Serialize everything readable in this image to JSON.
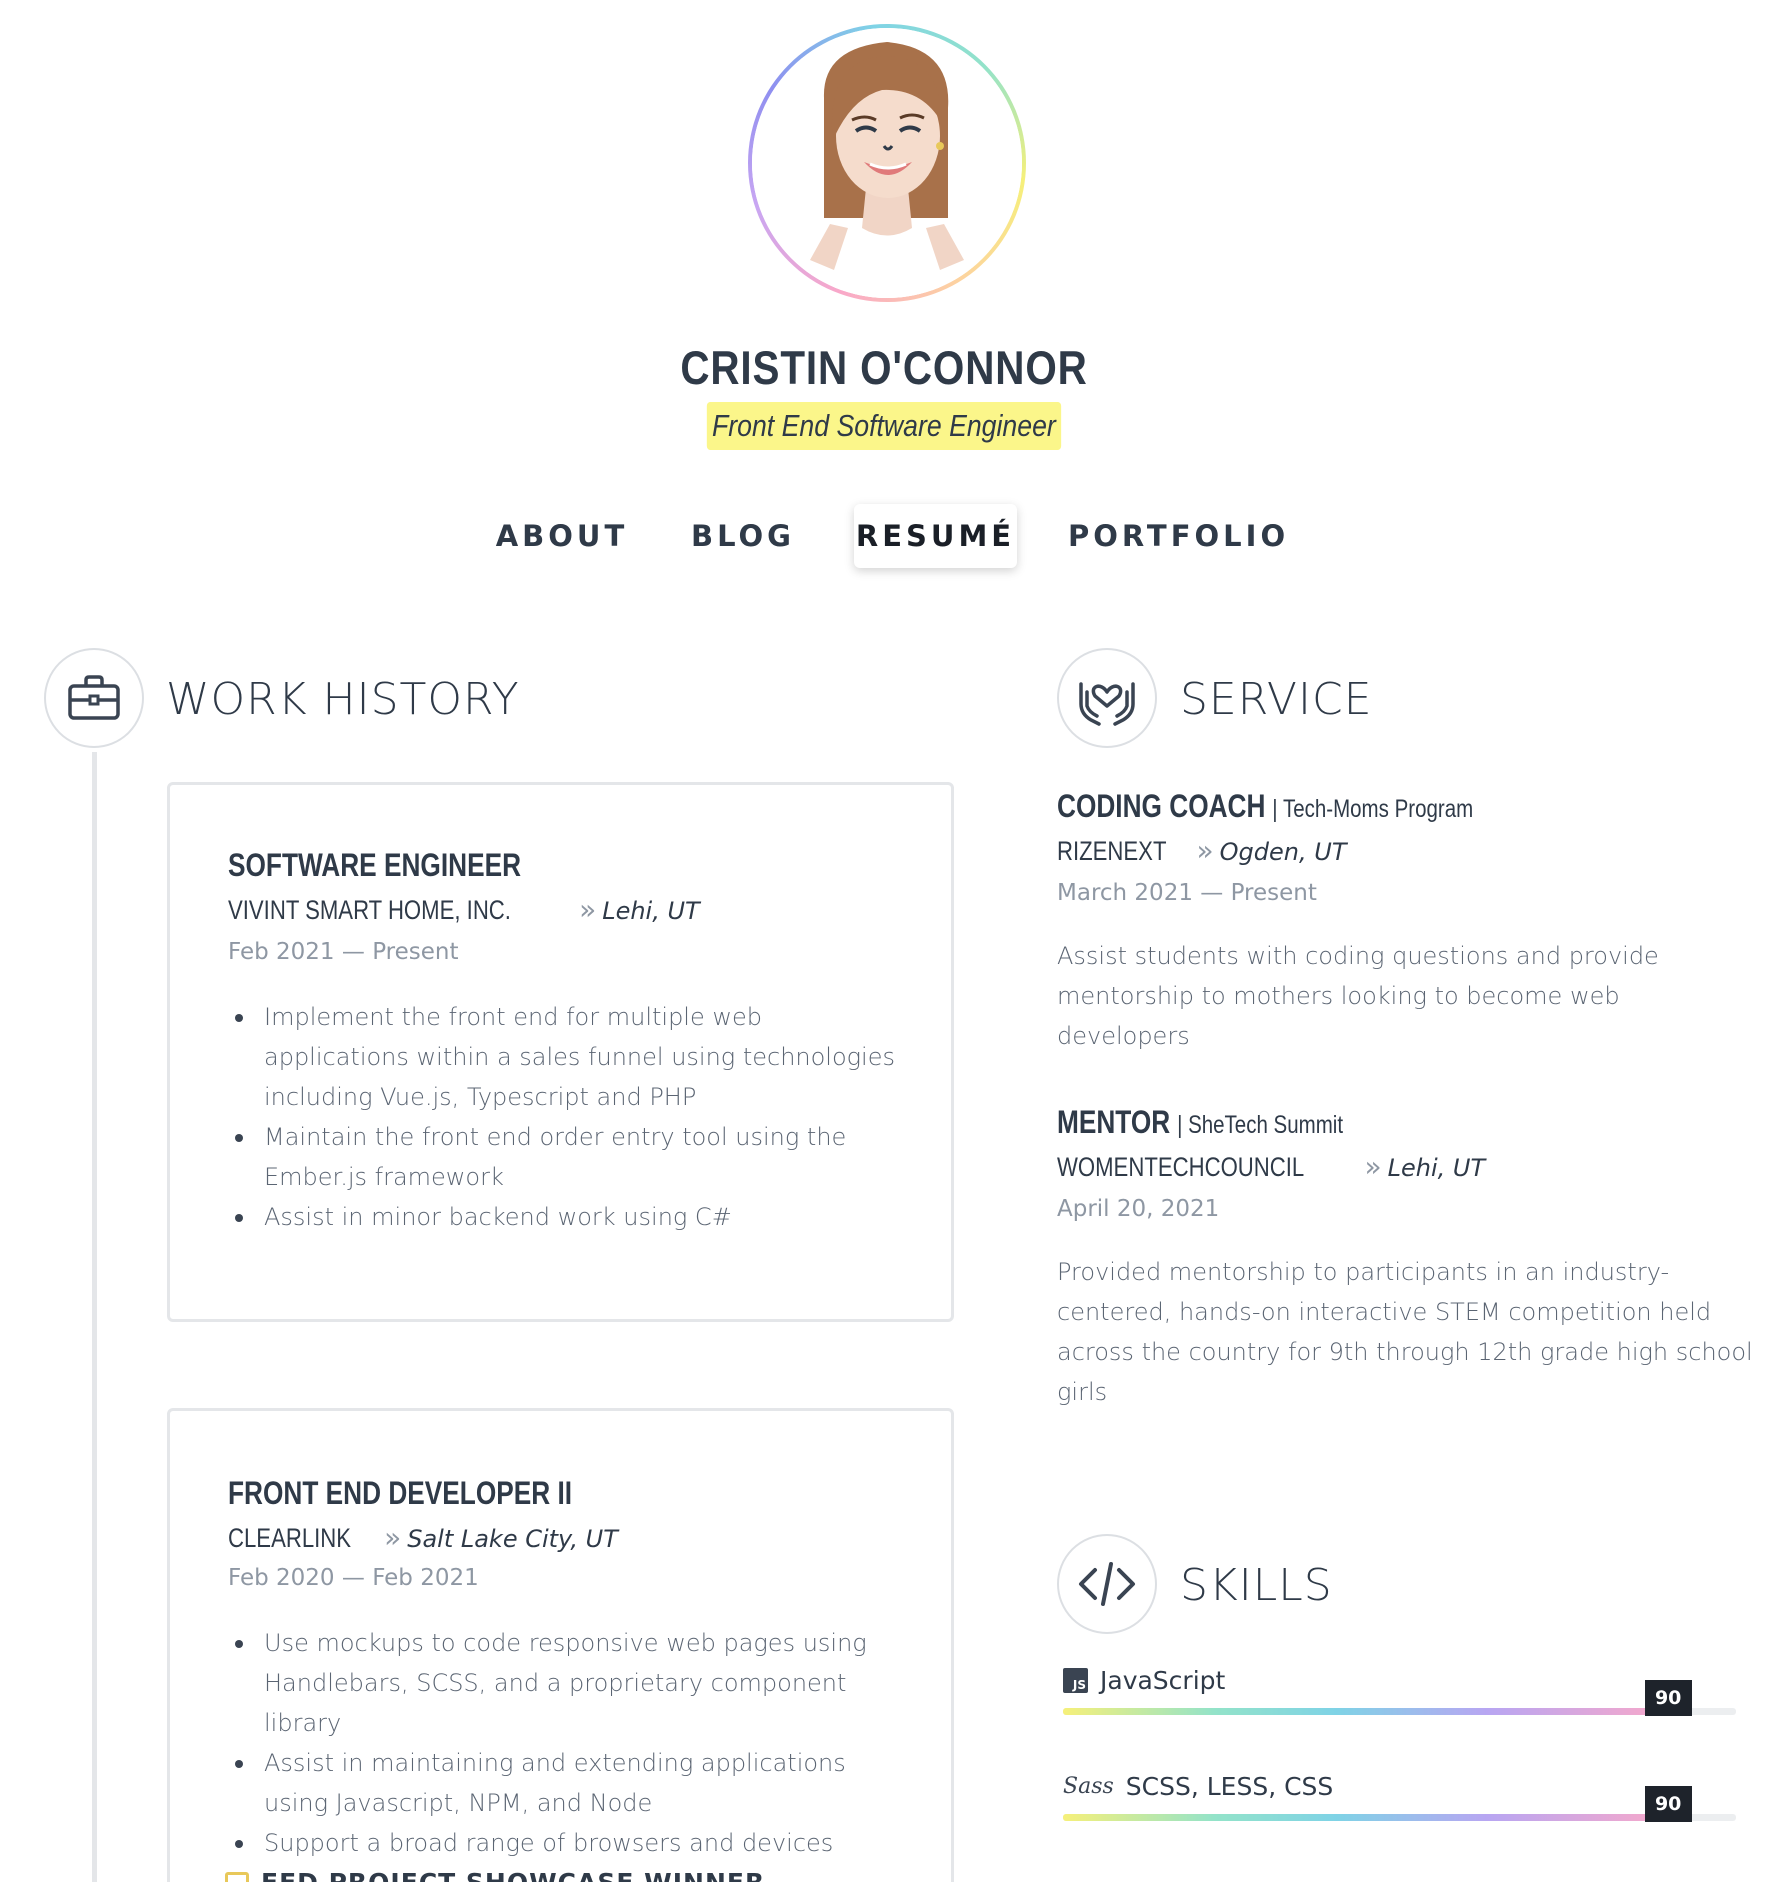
{
  "header": {
    "name": "CRISTIN O'CONNOR",
    "tagline": "Front End Software Engineer",
    "avatar_icon": "avatar-illustration"
  },
  "nav": {
    "items": [
      {
        "label": "ABOUT",
        "active": false
      },
      {
        "label": "BLOG",
        "active": false
      },
      {
        "label": "RESUMÉ",
        "active": true
      },
      {
        "label": "PORTFOLIO",
        "active": false
      }
    ]
  },
  "work_history": {
    "title": "WORK HISTORY",
    "icon": "briefcase-icon",
    "jobs": [
      {
        "title": "SOFTWARE ENGINEER",
        "company": "VIVINT SMART HOME, INC.",
        "location": "Lehi, UT",
        "dates": "Feb 2021 — Present",
        "bullets": [
          "Implement the front end for multiple web applications within a sales funnel using technologies including Vue.js, Typescript and PHP",
          "Maintain the front end order entry tool using the Ember.js framework",
          "Assist in minor backend work using C#"
        ]
      },
      {
        "title": "FRONT END DEVELOPER II",
        "company": "CLEARLINK",
        "location": "Salt Lake City, UT",
        "dates": "Feb 2020 — Feb 2021",
        "bullets": [
          "Use mockups to code responsive web pages using Handlebars, SCSS, and a proprietary component library",
          "Assist in maintaining and extending applications using Javascript, NPM, and Node",
          "Support a broad range of browsers and devices"
        ],
        "award": "FED PROJECT SHOWCASE WINNER"
      }
    ]
  },
  "service": {
    "title": "SERVICE",
    "icon": "heart-hands-icon",
    "items": [
      {
        "role": "CODING COACH",
        "program": "| Tech-Moms Program",
        "org": "RIZENEXT",
        "location": "Ogden, UT",
        "date": "March 2021 — Present",
        "description": "Assist students with coding questions and provide mentorship to mothers looking to become web developers"
      },
      {
        "role": "MENTOR",
        "program": "| SheTech Summit",
        "org": "WOMENTECHCOUNCIL",
        "location": "Lehi, UT",
        "date": "April 20, 2021",
        "description": "Provided mentorship to participants in an industry-centered, hands-on interactive STEM competition held across the country for 9th through 12th grade high school girls"
      }
    ]
  },
  "skills": {
    "title": "SKILLS",
    "icon": "code-icon",
    "items": [
      {
        "name": "JavaScript",
        "icon": "js-icon",
        "icon_text": "JS",
        "level": 90
      },
      {
        "name": "SCSS, LESS, CSS",
        "icon": "sass-icon",
        "icon_text": "Sass",
        "level": 90
      }
    ]
  },
  "colors": {
    "text": "#2f3a48",
    "muted": "#8e97a3",
    "highlight": "#fbf68a",
    "border": "#e4e6e9",
    "badge": "#1e232b"
  }
}
